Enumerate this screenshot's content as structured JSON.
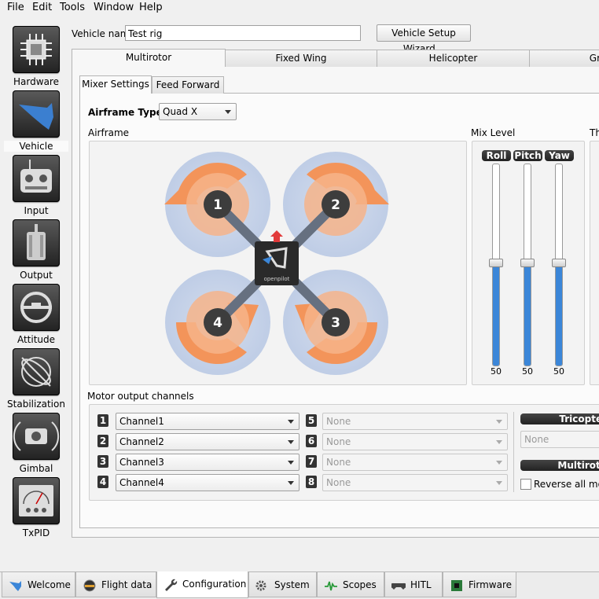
{
  "menu": [
    "File",
    "Edit",
    "Tools",
    "Window",
    "Help"
  ],
  "sidebar": [
    {
      "label": "Hardware",
      "icon": "chip-icon"
    },
    {
      "label": "Vehicle",
      "icon": "vehicle-icon"
    },
    {
      "label": "Input",
      "icon": "transmitter-icon"
    },
    {
      "label": "Output",
      "icon": "motor-icon"
    },
    {
      "label": "Attitude",
      "icon": "attitude-icon"
    },
    {
      "label": "Stabilization",
      "icon": "gyro-icon"
    },
    {
      "label": "Gimbal",
      "icon": "camera-icon"
    },
    {
      "label": "TxPID",
      "icon": "meter-icon"
    }
  ],
  "vehicle": {
    "name_label": "Vehicle name",
    "name_value": "Test rig",
    "wizard_button": "Vehicle Setup Wizard..."
  },
  "frame_tabs": [
    "Multirotor",
    "Fixed Wing",
    "Helicopter",
    "Gr"
  ],
  "inner_tabs": [
    "Mixer Settings",
    "Feed Forward"
  ],
  "airframe": {
    "type_label": "Airframe Type:",
    "type_value": "Quad X",
    "group_label": "Airframe",
    "motors": [
      "1",
      "2",
      "3",
      "4"
    ],
    "logo_text": "openpilot"
  },
  "mix_level": {
    "label": "Mix Level",
    "sliders": [
      {
        "name": "Roll",
        "value": 50
      },
      {
        "name": "Pitch",
        "value": 50
      },
      {
        "name": "Yaw",
        "value": 50
      }
    ],
    "right_label": "Th"
  },
  "motor_output": {
    "label": "Motor output channels",
    "left": [
      {
        "num": "1",
        "value": "Channel1"
      },
      {
        "num": "2",
        "value": "Channel2"
      },
      {
        "num": "3",
        "value": "Channel3"
      },
      {
        "num": "4",
        "value": "Channel4"
      }
    ],
    "right": [
      {
        "num": "5",
        "value": "None"
      },
      {
        "num": "6",
        "value": "None"
      },
      {
        "num": "7",
        "value": "None"
      },
      {
        "num": "8",
        "value": "None"
      }
    ],
    "tricopter_header": "Tricopter",
    "tricopter_value": "None",
    "multirotor_header": "Multiroto",
    "reverse_label": "Reverse all motor"
  },
  "bottom_tabs": [
    {
      "label": "Welcome",
      "icon": "bird-icon"
    },
    {
      "label": "Flight data",
      "icon": "gauge-icon"
    },
    {
      "label": "Configuration",
      "icon": "wrench-icon"
    },
    {
      "label": "System",
      "icon": "gears-icon"
    },
    {
      "label": "Scopes",
      "icon": "pulse-icon"
    },
    {
      "label": "HITL",
      "icon": "gamepad-icon"
    },
    {
      "label": "Firmware",
      "icon": "board-icon"
    }
  ]
}
